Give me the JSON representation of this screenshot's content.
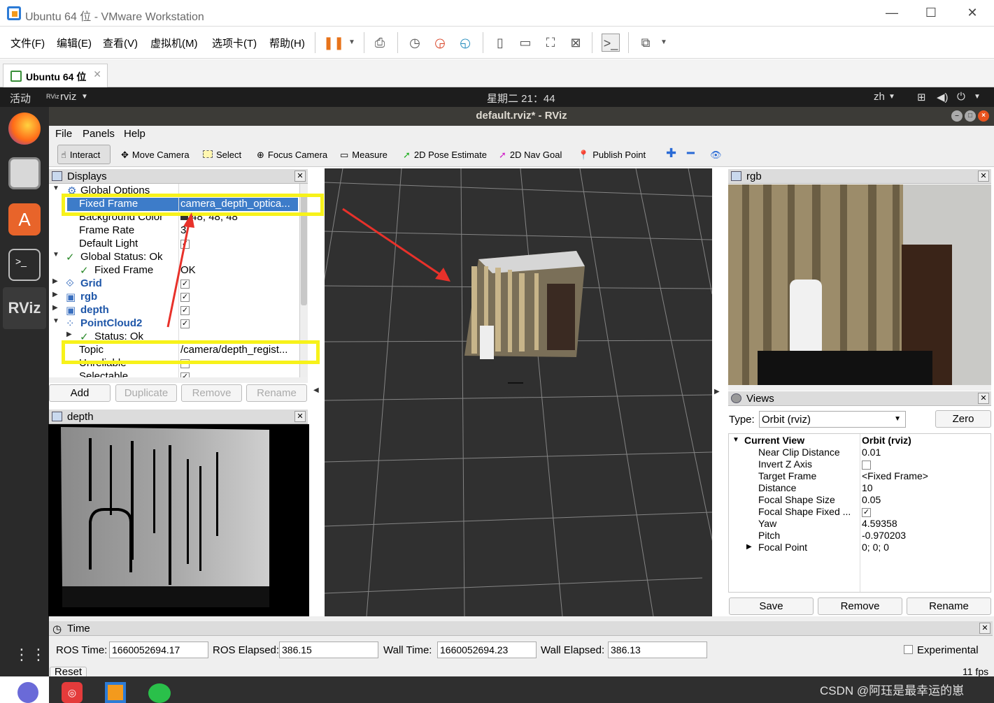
{
  "vmware": {
    "title": "Ubuntu 64 位 - VMware Workstation",
    "menus": [
      "文件(F)",
      "编辑(E)",
      "查看(V)",
      "虚拟机(M)",
      "选项卡(T)",
      "帮助(H)"
    ],
    "tab": "Ubuntu 64 位"
  },
  "ubuntu": {
    "activities": "活动",
    "app": "rviz",
    "clock": "星期二 21：44",
    "lang": "zh"
  },
  "rviz": {
    "title": "default.rviz* - RViz",
    "menus": [
      "File",
      "Panels",
      "Help"
    ],
    "tools": [
      "Interact",
      "Move Camera",
      "Select",
      "Focus Camera",
      "Measure",
      "2D Pose Estimate",
      "2D Nav Goal",
      "Publish Point"
    ],
    "displays": {
      "title": "Displays",
      "rows": [
        {
          "k": "Global Options",
          "v": ""
        },
        {
          "k": "Fixed Frame",
          "v": "camera_depth_optica..."
        },
        {
          "k": "Background Color",
          "v": "48; 48; 48"
        },
        {
          "k": "Frame Rate",
          "v": "3"
        },
        {
          "k": "Default Light",
          "v": ""
        },
        {
          "k": "Global Status: Ok",
          "v": ""
        },
        {
          "k": "Fixed Frame",
          "v": "OK"
        },
        {
          "k": "Grid",
          "v": ""
        },
        {
          "k": "rgb",
          "v": ""
        },
        {
          "k": "depth",
          "v": ""
        },
        {
          "k": "PointCloud2",
          "v": ""
        },
        {
          "k": "Status: Ok",
          "v": ""
        },
        {
          "k": "Topic",
          "v": "/camera/depth_regist..."
        },
        {
          "k": "Unreliable",
          "v": ""
        },
        {
          "k": "Selectable",
          "v": ""
        }
      ],
      "buttons": [
        "Add",
        "Duplicate",
        "Remove",
        "Rename"
      ]
    },
    "depth_title": "depth",
    "rgb_title": "rgb",
    "views": {
      "title": "Views",
      "type_label": "Type:",
      "type_value": "Orbit (rviz)",
      "zero": "Zero",
      "rows": [
        {
          "k": "Current View",
          "v": "Orbit (rviz)"
        },
        {
          "k": "Near Clip Distance",
          "v": "0.01"
        },
        {
          "k": "Invert Z Axis",
          "v": ""
        },
        {
          "k": "Target Frame",
          "v": "<Fixed Frame>"
        },
        {
          "k": "Distance",
          "v": "10"
        },
        {
          "k": "Focal Shape Size",
          "v": "0.05"
        },
        {
          "k": "Focal Shape Fixed ...",
          "v": ""
        },
        {
          "k": "Yaw",
          "v": "4.59358"
        },
        {
          "k": "Pitch",
          "v": "-0.970203"
        },
        {
          "k": "Focal Point",
          "v": "0; 0; 0"
        }
      ],
      "buttons": [
        "Save",
        "Remove",
        "Rename"
      ]
    },
    "time": {
      "title": "Time",
      "ros_time_label": "ROS Time:",
      "ros_time": "1660052694.17",
      "ros_elapsed_label": "ROS Elapsed:",
      "ros_elapsed": "386.15",
      "wall_time_label": "Wall Time:",
      "wall_time": "1660052694.23",
      "wall_elapsed_label": "Wall Elapsed:",
      "wall_elapsed": "386.13",
      "experimental": "Experimental",
      "reset": "Reset",
      "fps": "11 fps"
    }
  },
  "watermark": "CSDN @阿珏是最幸运的崽",
  "colors": {
    "highlight": "#f7f21a",
    "selection": "#3d7cc9",
    "viewport_bg": "#303030",
    "arrow": "#e8312a"
  }
}
